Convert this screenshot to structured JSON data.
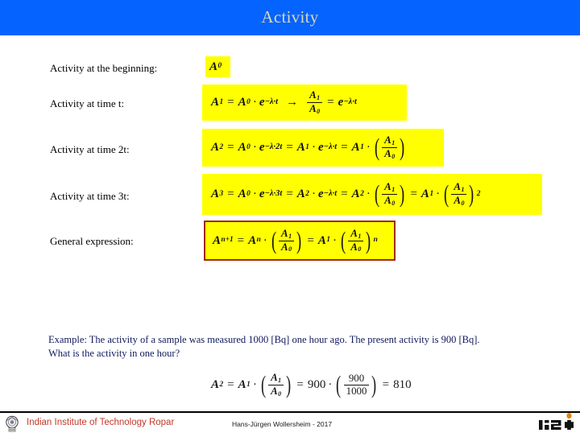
{
  "slide": {
    "title": "Activity",
    "title_band_color": "#0563ff",
    "title_text_color": "#d8d8b0"
  },
  "rows": [
    {
      "label": "Activity at the beginning:"
    },
    {
      "label": "Activity at time t:"
    },
    {
      "label": "Activity at time 2t:"
    },
    {
      "label": "Activity at time 3t:"
    },
    {
      "label": "General expression:"
    }
  ],
  "formulas": {
    "highlight_color": "#ffff00",
    "border_color": "#9e2a12",
    "row1_plain": "A0",
    "row2_plain": "A1 = A0 · e^(−λ·t)   →   A1/A0 = e^(−λ·t)",
    "row3_plain": "A2 = A0 · e^(−λ·2t) = A1 · e^(−λ·t) = A1 · (A1/A0)",
    "row4_plain": "A3 = A0 · e^(−λ·3t) = A2 · e^(−λ·t) = A2 · (A1/A0) = A1 · (A1/A0)^2",
    "row5_plain": "An+1 = An · (A1/A0) = A1 · (A1/A0)^n",
    "example_plain": "A2 = A1 · (A1/A0) = 900 · (900/1000) = 810"
  },
  "example": {
    "text_color": "#101a5c",
    "line1": "Example: The activity of a sample was measured 1000 [Bq] one hour ago. The present activity is 900 [Bq].",
    "line2": "What is the activity in one hour?",
    "measured_value": "1000",
    "present_value": "900",
    "result_value": "810",
    "unit": "[Bq]"
  },
  "footer": {
    "institute": "Indian Institute of Technology Ropar",
    "institute_color": "#c0392b",
    "author": "Hans-Jürgen Wollersheim - 2017",
    "gsi_label": "GSI"
  }
}
